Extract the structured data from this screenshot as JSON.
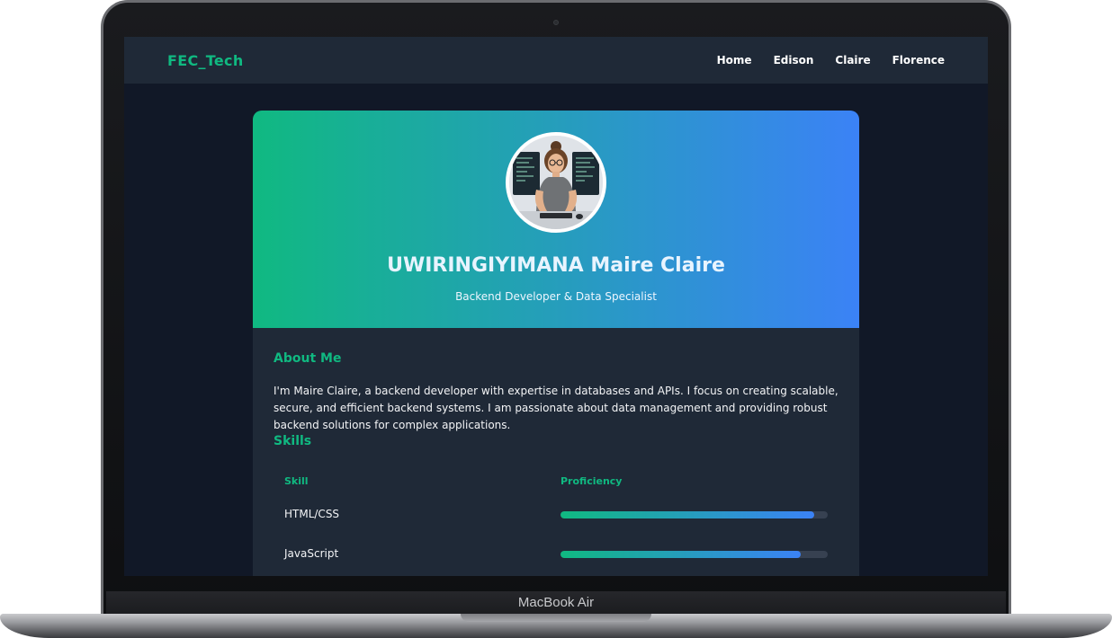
{
  "device": {
    "label": "MacBook Air"
  },
  "navbar": {
    "brand": "FEC_Tech",
    "links": [
      "Home",
      "Edison",
      "Claire",
      "Florence"
    ]
  },
  "profile": {
    "name": "UWIRINGIYIMANA Maire Claire",
    "role": "Backend Developer & Data Specialist",
    "avatar_icon": "developer-portrait"
  },
  "about": {
    "title": "About Me",
    "text": "I'm Maire Claire, a backend developer with expertise in databases and APIs. I focus on creating scalable, secure, and efficient backend systems. I am passionate about data management and providing robust backend solutions for complex applications."
  },
  "skills": {
    "title": "Skills",
    "headers": {
      "skill": "Skill",
      "proficiency": "Proficiency"
    },
    "rows": [
      {
        "name": "HTML/CSS",
        "proficiency": 0.95
      },
      {
        "name": "JavaScript",
        "proficiency": 0.9
      }
    ]
  },
  "colors": {
    "accent": "#10b981",
    "gradient_end": "#3b82f6",
    "background": "#111827",
    "surface": "#1f2937"
  }
}
